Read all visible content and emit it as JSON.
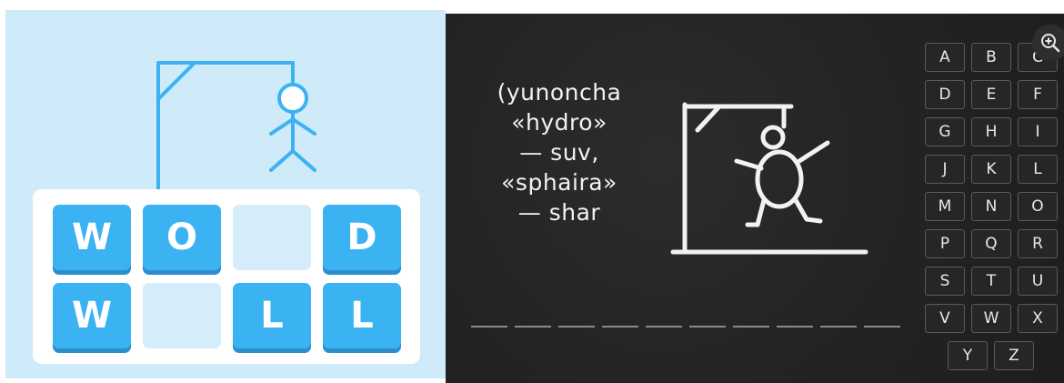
{
  "left_game": {
    "tiles_row1": [
      "W",
      "O",
      "",
      "D"
    ],
    "tiles_row2": [
      "W",
      "",
      "L",
      "L"
    ],
    "colors": {
      "background": "#cfeaf9",
      "tile": "#3bb3f3",
      "tile_empty": "#d5ecfb",
      "gallows": "#3bb3f3"
    }
  },
  "right_game": {
    "clue_lines": [
      "(yunoncha",
      "«hydro»",
      "— suv,",
      "«sphaira»",
      "— shar"
    ],
    "blank_count": 10,
    "keyboard": [
      [
        "A",
        "B",
        "C"
      ],
      [
        "D",
        "E",
        "F"
      ],
      [
        "G",
        "H",
        "I"
      ],
      [
        "J",
        "K",
        "L"
      ],
      [
        "M",
        "N",
        "O"
      ],
      [
        "P",
        "Q",
        "R"
      ],
      [
        "S",
        "T",
        "U"
      ],
      [
        "V",
        "W",
        "X"
      ],
      [
        "Y",
        "Z"
      ]
    ],
    "zoom_icon": "zoom-in-icon",
    "colors": {
      "board": "#242424",
      "chalk": "#f2f2f2"
    }
  }
}
